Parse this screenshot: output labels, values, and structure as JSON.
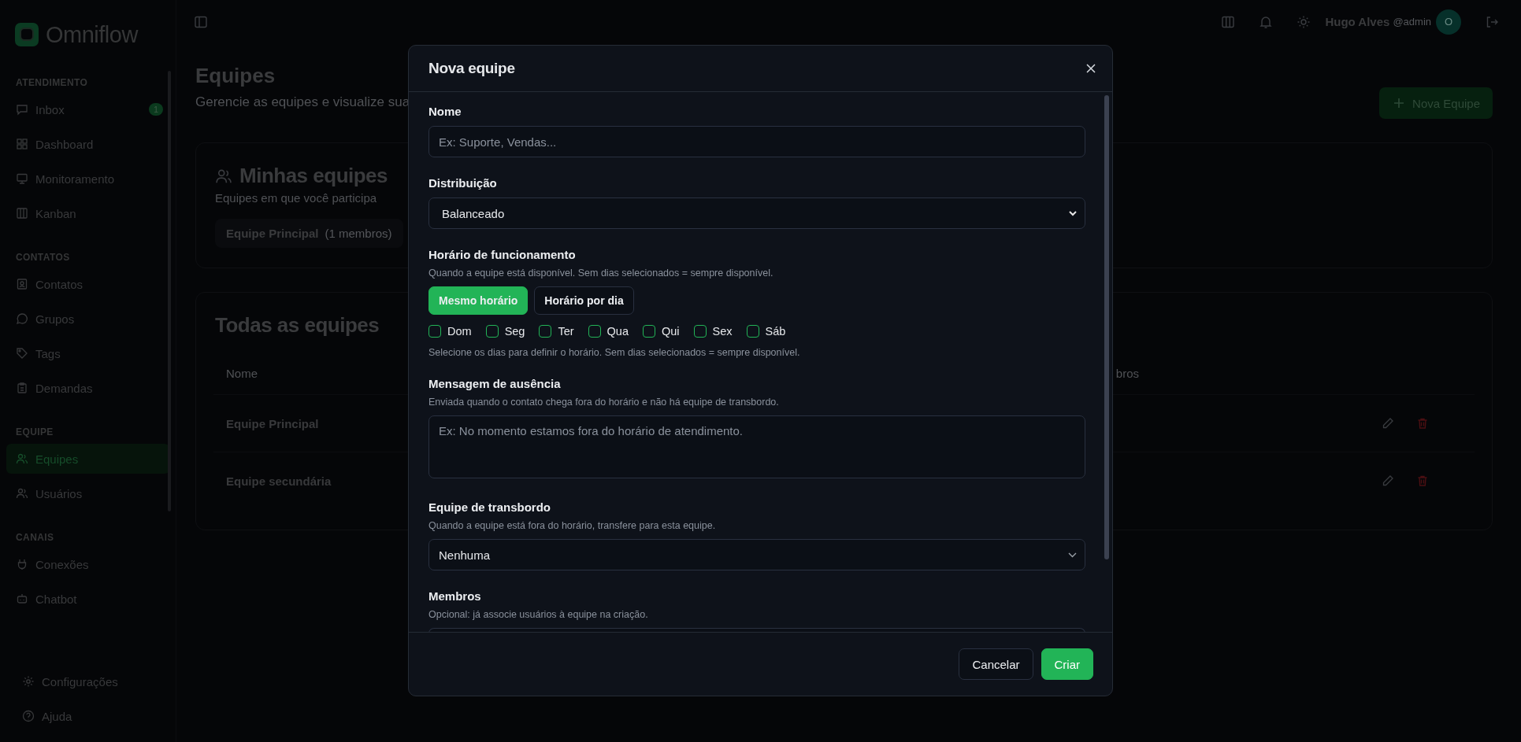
{
  "sidebar": {
    "logo": "Omniflow",
    "sections": [
      {
        "title": "ATENDIMENTO",
        "items": [
          {
            "label": "Inbox",
            "badge": "1",
            "selected": false
          },
          {
            "label": "Dashboard",
            "selected": false
          },
          {
            "label": "Monitoramento",
            "selected": false
          },
          {
            "label": "Kanban",
            "selected": false
          }
        ]
      },
      {
        "title": "CONTATOS",
        "items": [
          {
            "label": "Contatos",
            "selected": false
          },
          {
            "label": "Grupos",
            "selected": false
          },
          {
            "label": "Tags",
            "selected": false
          },
          {
            "label": "Demandas",
            "selected": false
          }
        ]
      },
      {
        "title": "EQUIPE",
        "items": [
          {
            "label": "Equipes",
            "selected": true
          },
          {
            "label": "Usuários",
            "selected": false
          }
        ]
      },
      {
        "title": "CANAIS",
        "items": [
          {
            "label": "Conexões",
            "selected": false
          },
          {
            "label": "Chatbot",
            "selected": false
          }
        ]
      }
    ],
    "footer_items": [
      {
        "label": "Configurações"
      },
      {
        "label": "Ajuda"
      }
    ]
  },
  "topbar": {
    "user_name": "Hugo Alves",
    "user_handle": "@admin",
    "avatar_initial": "O"
  },
  "page": {
    "title": "Equipes",
    "subtitle": "Gerencie as equipes e visualize sua",
    "new_button": "Nova Equipe",
    "my_teams": {
      "title": "Minhas equipes",
      "subtitle": "Equipes em que você participa",
      "teams": [
        {
          "name": "Equipe Principal",
          "members": "(1 membros)"
        }
      ]
    },
    "all_teams": {
      "title": "Todas as equipes",
      "columns": [
        "Nome",
        "bros"
      ],
      "rows": [
        {
          "name": "Equipe Principal"
        },
        {
          "name": "Equipe secundária"
        }
      ]
    }
  },
  "modal": {
    "title": "Nova equipe",
    "fields": [
      {
        "kind": "text",
        "label": "Nome",
        "placeholder": "Ex: Suporte, Vendas..."
      },
      {
        "kind": "select",
        "label": "Distribuição",
        "value": "Balanceado"
      },
      {
        "kind": "schedule",
        "label": "Horário de funcionamento",
        "hint": "Quando a equipe está disponível. Sem dias selecionados = sempre disponível.",
        "modes": [
          {
            "label": "Mesmo horário",
            "selected": true
          },
          {
            "label": "Horário por dia",
            "selected": false
          }
        ],
        "days": [
          {
            "label": "Dom",
            "checked": false
          },
          {
            "label": "Seg",
            "checked": false
          },
          {
            "label": "Ter",
            "checked": false
          },
          {
            "label": "Qua",
            "checked": false
          },
          {
            "label": "Qui",
            "checked": false
          },
          {
            "label": "Sex",
            "checked": false
          },
          {
            "label": "Sáb",
            "checked": false
          }
        ],
        "days_hint": "Selecione os dias para definir o horário. Sem dias selecionados = sempre disponível."
      },
      {
        "kind": "textarea",
        "label": "Mensagem de ausência",
        "hint": "Enviada quando o contato chega fora do horário e não há equipe de transbordo.",
        "placeholder": "Ex: No momento estamos fora do horário de atendimento."
      },
      {
        "kind": "combobox",
        "label": "Equipe de transbordo",
        "hint": "Quando a equipe está fora do horário, transfere para esta equipe.",
        "value": "Nenhuma"
      },
      {
        "kind": "members",
        "label": "Membros",
        "hint": "Opcional: já associe usuários à equipe na criação."
      }
    ],
    "buttons": [
      {
        "kind": "secondary",
        "label": "Cancelar"
      },
      {
        "kind": "primary",
        "label": "Criar"
      }
    ]
  }
}
